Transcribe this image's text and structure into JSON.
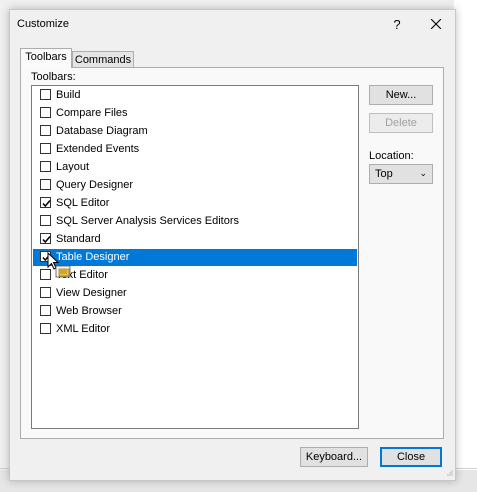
{
  "dialog": {
    "title": "Customize",
    "help_label": "?",
    "close_icon": "close-icon"
  },
  "tabs": [
    {
      "label": "Toolbars",
      "active": true
    },
    {
      "label": "Commands",
      "active": false
    }
  ],
  "toolbars_label": "Toolbars:",
  "toolbar_items": [
    {
      "label": "Build",
      "checked": false
    },
    {
      "label": "Compare Files",
      "checked": false
    },
    {
      "label": "Database Diagram",
      "checked": false
    },
    {
      "label": "Extended Events",
      "checked": false
    },
    {
      "label": "Layout",
      "checked": false
    },
    {
      "label": "Query Designer",
      "checked": false
    },
    {
      "label": "SQL Editor",
      "checked": true
    },
    {
      "label": "SQL Server Analysis Services Editors",
      "checked": false
    },
    {
      "label": "Standard",
      "checked": true
    },
    {
      "label": "Table Designer",
      "checked": true,
      "selected": true
    },
    {
      "label": "Text Editor",
      "checked": false
    },
    {
      "label": "View Designer",
      "checked": false
    },
    {
      "label": "Web Browser",
      "checked": false
    },
    {
      "label": "XML Editor",
      "checked": false
    }
  ],
  "buttons": {
    "new_label": "New...",
    "delete_label": "Delete",
    "keyboard_label": "Keyboard...",
    "close_label": "Close"
  },
  "location": {
    "label": "Location:",
    "value": "Top"
  },
  "colors": {
    "selection": "#0078d7",
    "dialog_bg": "#f0f0f0",
    "default_button_border": "#0078d7"
  }
}
